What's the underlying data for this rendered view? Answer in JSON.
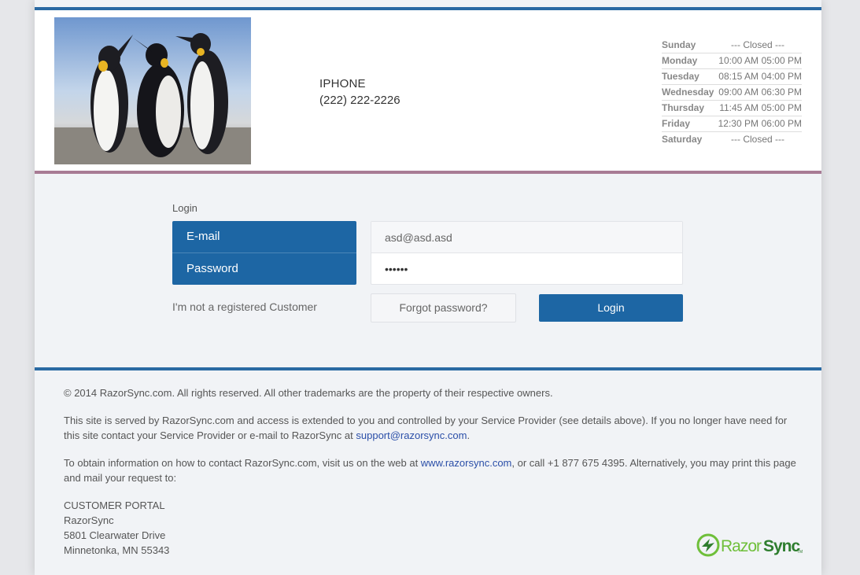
{
  "header": {
    "contact_name": "IPHONE",
    "contact_phone": "(222) 222-2226",
    "hours": [
      {
        "day": "Sunday",
        "closed": "--- Closed ---"
      },
      {
        "day": "Monday",
        "open": "10:00 AM",
        "close": "05:00 PM"
      },
      {
        "day": "Tuesday",
        "open": "08:15 AM",
        "close": "04:00 PM"
      },
      {
        "day": "Wednesday",
        "open": "09:00 AM",
        "close": "06:30 PM"
      },
      {
        "day": "Thursday",
        "open": "11:45 AM",
        "close": "05:00 PM"
      },
      {
        "day": "Friday",
        "open": "12:30 PM",
        "close": "06:00 PM"
      },
      {
        "day": "Saturday",
        "closed": "--- Closed ---"
      }
    ]
  },
  "login": {
    "caption": "Login",
    "email_label": "E-mail",
    "password_label": "Password",
    "email_value": "asd@asd.asd",
    "password_value": "••••••",
    "not_registered": "I'm not a registered Customer",
    "forgot": "Forgot password?",
    "button": "Login"
  },
  "footer": {
    "copyright": "© 2014 RazorSync.com. All rights reserved. All other trademarks are the property of their respective owners.",
    "served_text": "This site is served by RazorSync.com and access is extended to you and controlled by your Service Provider (see details above). If you no longer have need for this site contact your Service Provider or e-mail to RazorSync at ",
    "support_email": "support@razorsync.com",
    "served_end": ".",
    "contact_text": "To obtain information on how to contact RazorSync.com, visit us on the web at ",
    "website": "www.razorsync.com",
    "contact_end": ", or call +1 877 675 4395. Alternatively, you may print this page and mail your request to:",
    "address": [
      "CUSTOMER PORTAL",
      "RazorSync",
      "5801 Clearwater Drive",
      "Minnetonka, MN 55343"
    ]
  },
  "brand": {
    "name_part1": "Razor",
    "name_part2": "Sync",
    "tm": "TM",
    "color_dark": "#2e7d2e",
    "color_light": "#6fbf3a"
  },
  "colors": {
    "accent_blue": "#1d66a4",
    "divider_mauve": "#a87b94"
  }
}
